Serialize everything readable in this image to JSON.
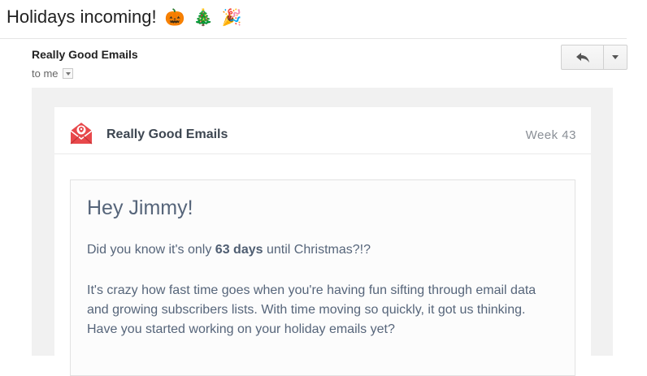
{
  "email": {
    "subject": "Holidays incoming!",
    "subject_emojis": [
      "🎃",
      "🎄",
      "🎉"
    ],
    "sender": "Really Good Emails",
    "to_label": "to me"
  },
  "toolbar": {
    "reply_icon": "reply-arrow-icon",
    "more_icon": "chevron-down-icon"
  },
  "body": {
    "brand_name": "Really Good Emails",
    "week_label": "Week 43",
    "greeting": "Hey Jimmy!",
    "para1_before": "Did you know it's only ",
    "para1_bold": "63 days",
    "para1_after": " until Christmas?!?",
    "para2": "It's crazy how fast time goes when you're having fun sifting through email data and growing subscribers lists. With time moving so quickly, it got us thinking. Have you started working on your holiday emails yet?"
  },
  "colors": {
    "brand_red": "#e8484b",
    "text_slate": "#56657a",
    "header_text": "#3d4651",
    "gray_bg": "#f1f1f1"
  }
}
